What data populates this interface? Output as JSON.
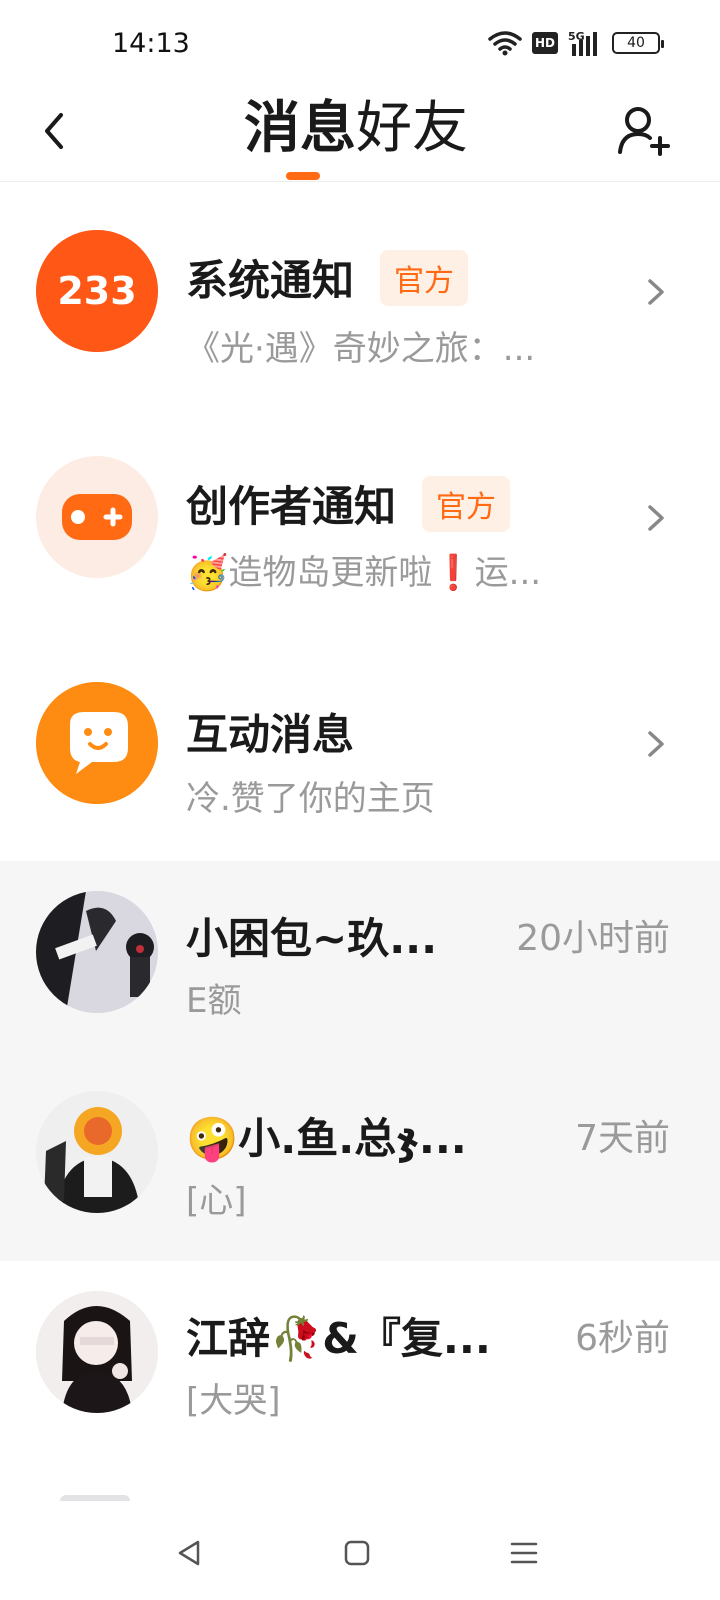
{
  "status": {
    "time": "14:13",
    "battery": "40",
    "hd_label": "HD",
    "network_label": "5G"
  },
  "nav": {
    "tab_messages": "消息",
    "tab_friends": "好友"
  },
  "official_items": [
    {
      "title": "系统通知",
      "badge": "官方",
      "subtitle": "《光·遇》奇妙之旅：...",
      "avatar_text": "233"
    },
    {
      "title": "创作者通知",
      "badge": "官方",
      "subtitle": "🥳造物岛更新啦❗运..."
    },
    {
      "title": "互动消息",
      "subtitle": "冷.赞了你的主页"
    }
  ],
  "chats": [
    {
      "name": "小困包~玖...",
      "time": "20小时前",
      "preview": "E额"
    },
    {
      "name": "🤪小.鱼.总ჯ...",
      "time": "7天前",
      "preview": "[心]"
    },
    {
      "name": "江辞🥀&『复...",
      "time": "6秒前",
      "preview": "[大哭]"
    }
  ],
  "colors": {
    "accent": "#ff6a13",
    "badge_bg": "#fff0e6"
  }
}
